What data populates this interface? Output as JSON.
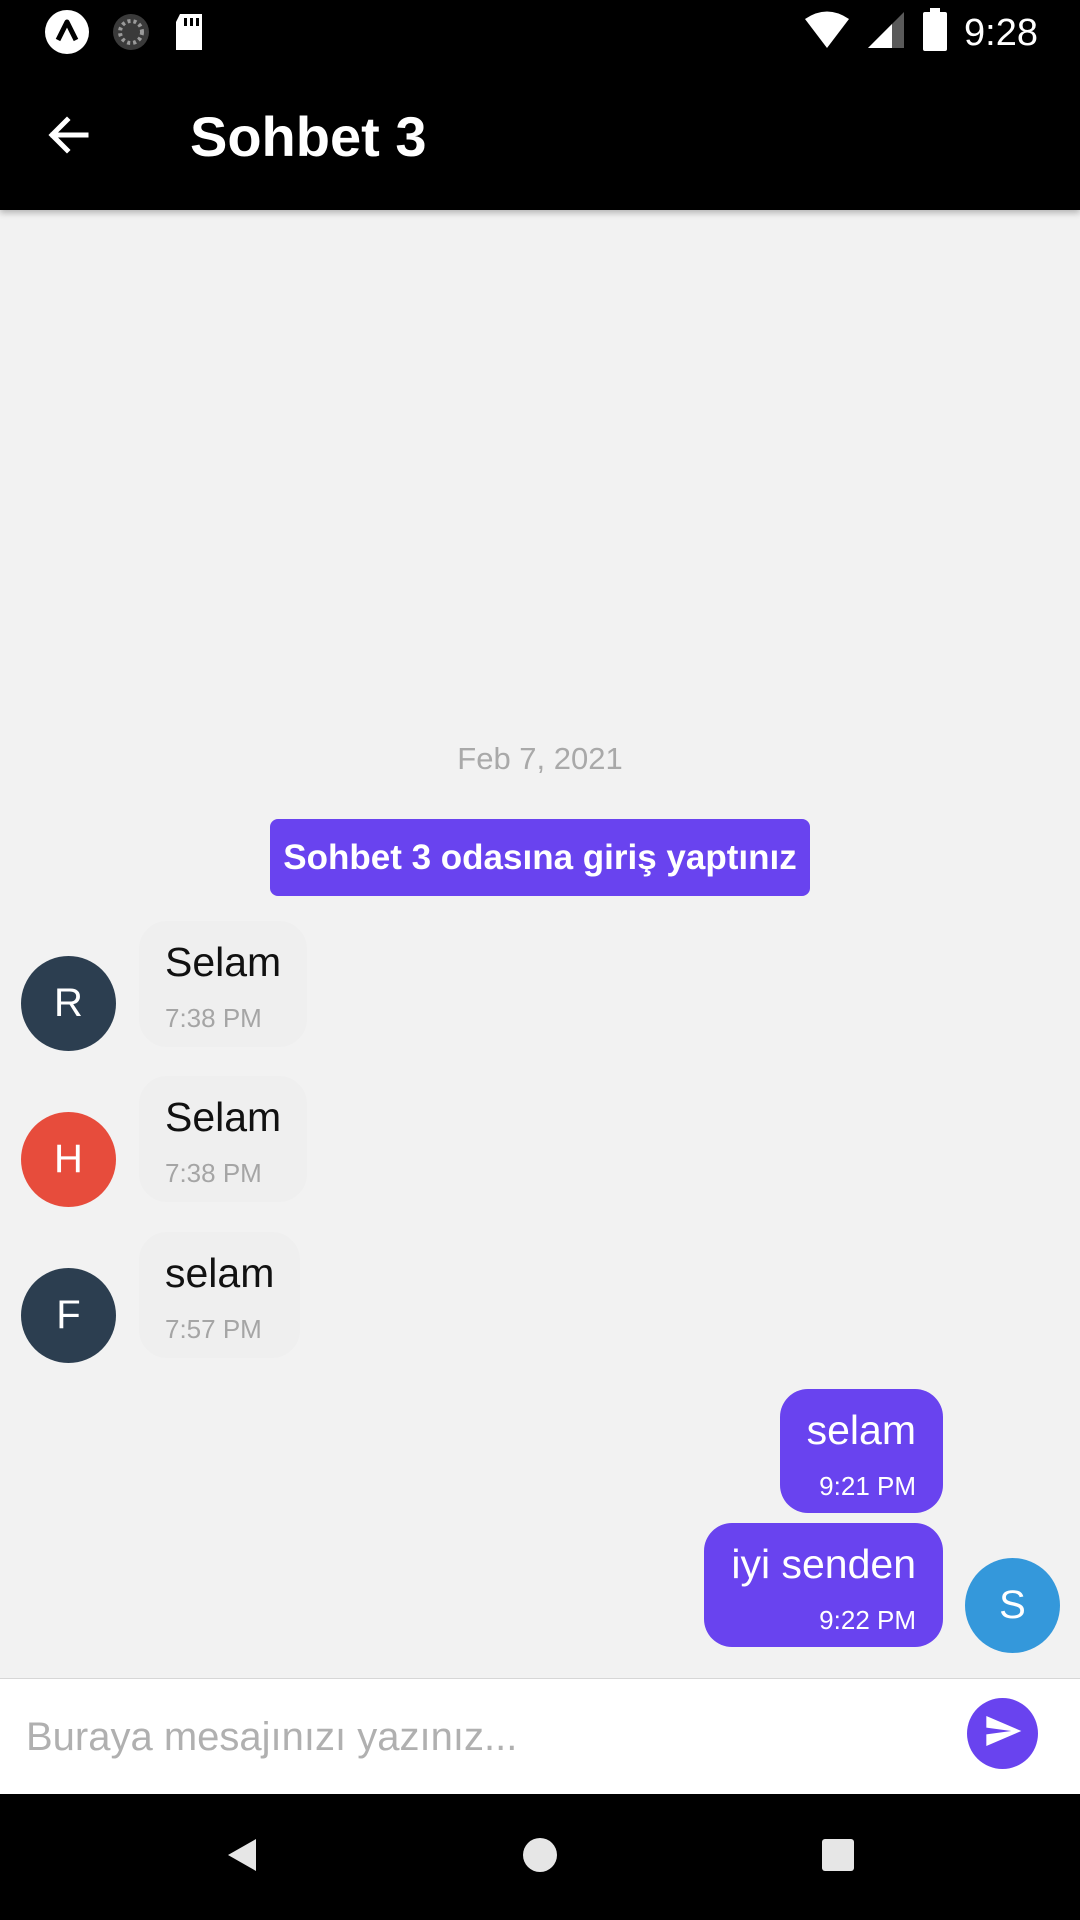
{
  "status_bar": {
    "time": "9:28",
    "left_icons": [
      "app-logo-icon",
      "loading-indicator-icon",
      "sd-card-icon"
    ],
    "right_icons": [
      "wifi-icon",
      "cell-signal-icon",
      "battery-icon"
    ]
  },
  "app_bar": {
    "title": "Sohbet 3",
    "back_icon": "arrow-left-icon"
  },
  "chat": {
    "date_separator": "Feb 7, 2021",
    "system_message": "Sohbet 3 odasına giriş yaptınız",
    "incoming": [
      {
        "initial": "R",
        "avatar_color": "#2c3e50",
        "text": "Selam",
        "time": "7:38 PM"
      },
      {
        "initial": "H",
        "avatar_color": "#e74c3c",
        "text": "Selam",
        "time": "7:38 PM"
      },
      {
        "initial": "F",
        "avatar_color": "#2c3e50",
        "text": "selam",
        "time": "7:57 PM"
      }
    ],
    "outgoing": [
      {
        "text": "selam",
        "time": "9:21 PM"
      },
      {
        "text": "iyi senden",
        "time": "9:22 PM"
      }
    ],
    "self_avatar": {
      "initial": "S",
      "color": "#3498db"
    }
  },
  "composer": {
    "placeholder": "Buraya mesajınızı yazınız...",
    "value": "",
    "send_icon": "send-icon"
  },
  "nav_bar": {
    "icons": [
      "nav-back-icon",
      "nav-home-icon",
      "nav-recents-icon"
    ]
  },
  "colors": {
    "accent": "#6943ef",
    "background": "#f2f2f2",
    "incoming_bubble": "#efefef"
  }
}
